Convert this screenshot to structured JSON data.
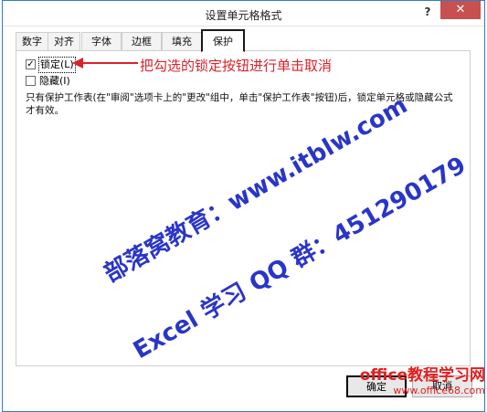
{
  "dialog": {
    "title": "设置单元格格式",
    "help_label": "?",
    "close_label": "✕"
  },
  "tabs": [
    {
      "label": "数字"
    },
    {
      "label": "对齐"
    },
    {
      "label": "字体"
    },
    {
      "label": "边框"
    },
    {
      "label": "填充"
    },
    {
      "label": "保护",
      "active": true
    }
  ],
  "protection": {
    "locked": {
      "label": "锁定(L)",
      "checked": true
    },
    "hidden": {
      "label": "隐藏(I)",
      "checked": false
    },
    "description": "只有保护工作表(在\"审阅\"选项卡上的\"更改\"组中，单击\"保护工作表\"按钮)后，锁定单元格或隐藏公式才有效。"
  },
  "annotation": {
    "text": "把勾选的锁定按钮进行单击取消",
    "color": "#d9232d"
  },
  "watermarks": {
    "line1": "部落窝教育：www.itblw.com",
    "line2": "Excel 学习 QQ 群：451290179",
    "color": "#2a35c8"
  },
  "buttons": {
    "ok_label": "确定",
    "cancel_label": "取消"
  },
  "site_watermark": {
    "title": "office教程学习网",
    "url": "www.office68.com"
  }
}
